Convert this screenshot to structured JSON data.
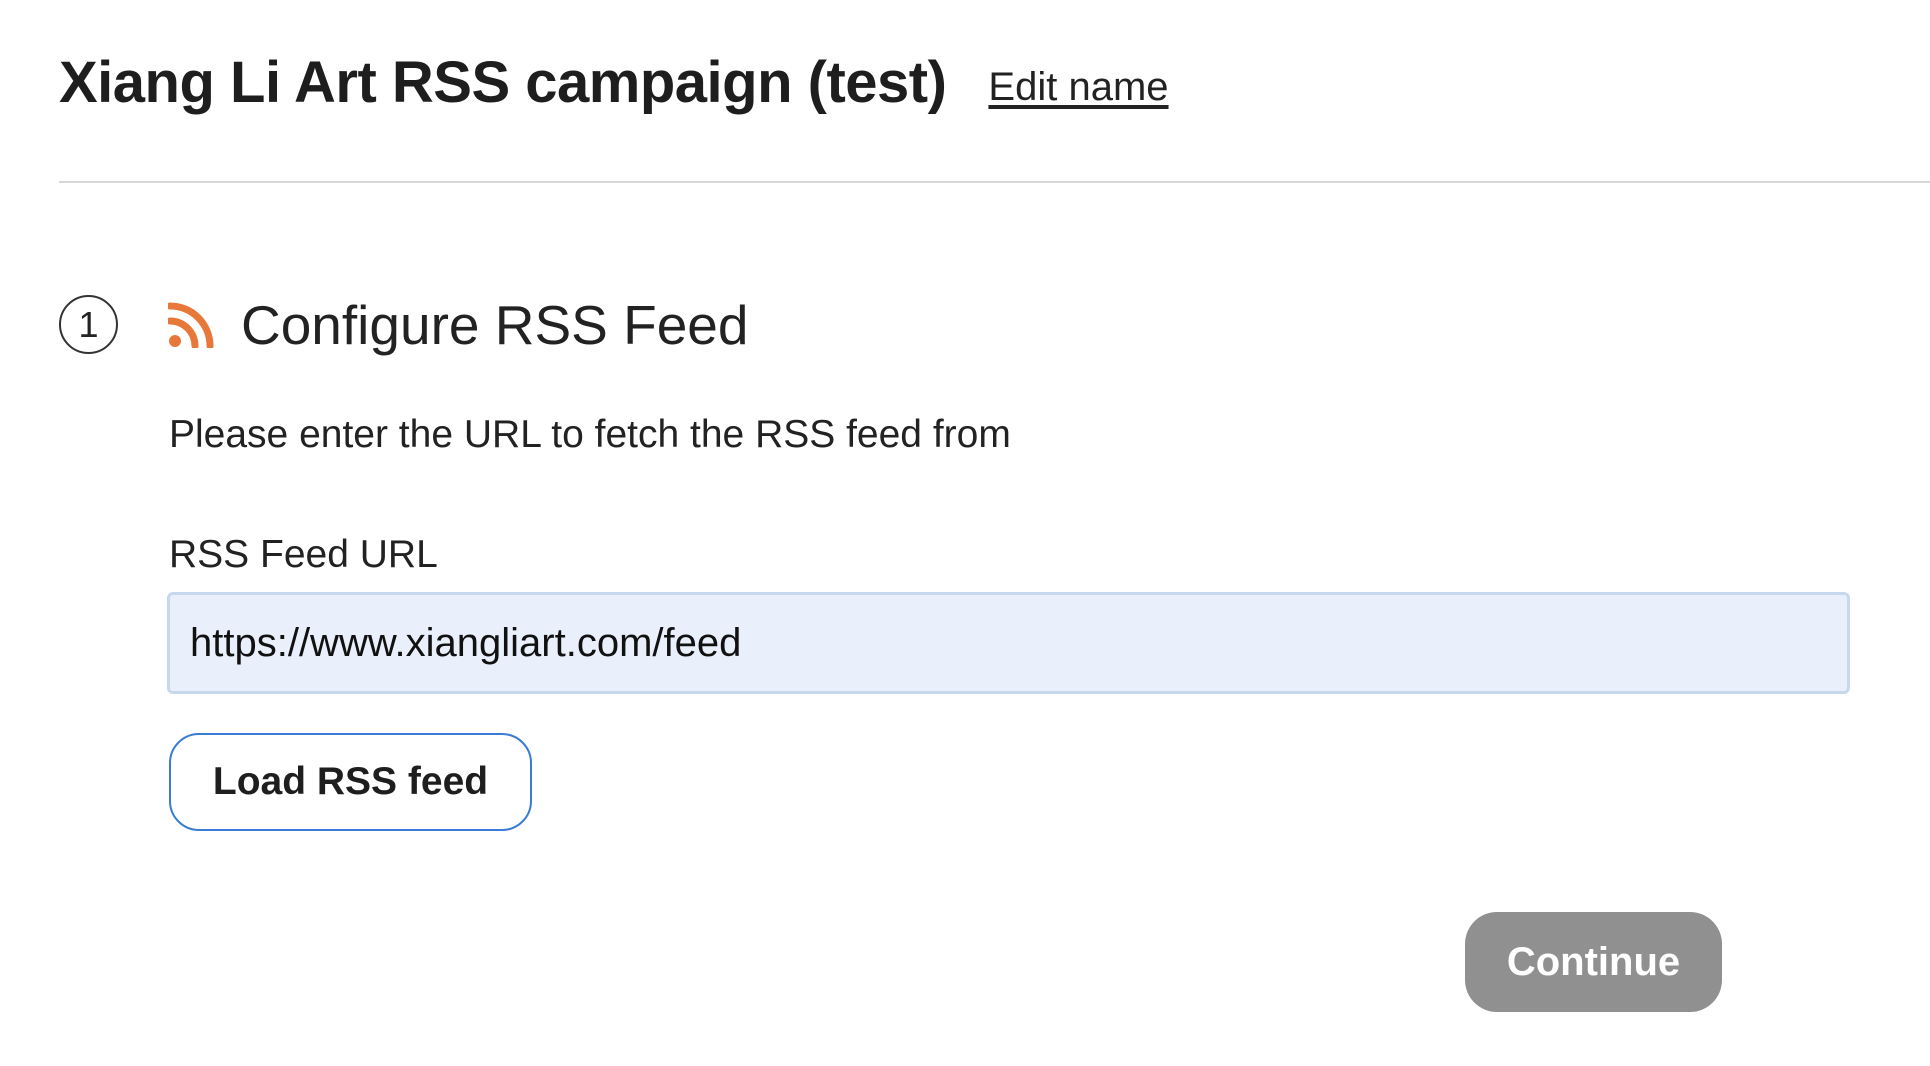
{
  "header": {
    "title": "Xiang Li Art RSS campaign (test)",
    "edit_link": "Edit name"
  },
  "step": {
    "number": "1",
    "icon": "rss-icon",
    "title": "Configure RSS Feed",
    "description": "Please enter the URL to fetch the RSS feed from"
  },
  "form": {
    "url_label": "RSS Feed URL",
    "url_value": "https://www.xiangliart.com/feed",
    "load_button": "Load RSS feed",
    "continue_button": "Continue"
  },
  "colors": {
    "rss_accent": "#e8773a",
    "input_background": "#e9f0fc",
    "load_button_border": "#3a7bd5",
    "continue_disabled": "#909090"
  }
}
